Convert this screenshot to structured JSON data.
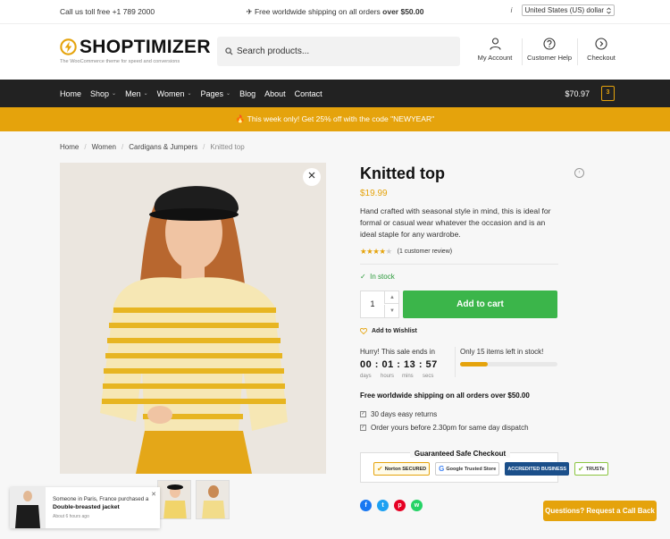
{
  "topbar": {
    "phone": "Call us toll free +1 789 2000",
    "shipping_prefix": "✈ Free worldwide shipping on all orders",
    "shipping_bold": "over $50.00",
    "info_icon": "i",
    "currency": "United States (US) dollar"
  },
  "header": {
    "logo_name": "SHOPTIMIZER",
    "tagline": "The WooCommerce theme for speed and conversions",
    "search_placeholder": "Search products...",
    "icons": [
      {
        "icon": "user-icon",
        "label": "My Account"
      },
      {
        "icon": "help-icon",
        "label": "Customer Help"
      },
      {
        "icon": "arrow-right-circle-icon",
        "label": "Checkout"
      }
    ]
  },
  "nav": {
    "items": [
      {
        "label": "Home",
        "dropdown": false
      },
      {
        "label": "Shop",
        "dropdown": true
      },
      {
        "label": "Men",
        "dropdown": true
      },
      {
        "label": "Women",
        "dropdown": true
      },
      {
        "label": "Pages",
        "dropdown": true
      },
      {
        "label": "Blog",
        "dropdown": false
      },
      {
        "label": "About",
        "dropdown": false
      },
      {
        "label": "Contact",
        "dropdown": false
      }
    ],
    "cart_total": "$70.97",
    "cart_count": "3"
  },
  "promo": {
    "text": "🔥 This week only! Get 25% off with the code \"NEWYEAR\""
  },
  "breadcrumb": [
    "Home",
    "Women",
    "Cardigans & Jumpers",
    "Knitted top"
  ],
  "product": {
    "title": "Knitted top",
    "price": "$19.99",
    "description": "Hand crafted with seasonal style in mind, this is ideal for formal or casual wear whatever the occasion and is an ideal staple for any wardrobe.",
    "rating": 4,
    "reviews": "(1 customer review)",
    "stock": "In stock",
    "quantity": "1",
    "add_to_cart": "Add to cart",
    "wishlist": "Add to Wishlist"
  },
  "sale": {
    "ends_label": "Hurry! This sale ends in",
    "time": "00 : 01 : 13 : 57",
    "units": [
      "days",
      "hours",
      "mins",
      "secs"
    ],
    "only_left": "Only 15 items left in stock!",
    "progress": 0.28
  },
  "shipping": {
    "headline": "Free worldwide shipping on all orders over $50.00",
    "bullets": [
      "30 days easy returns",
      "Order yours before 2.30pm for same day dispatch"
    ]
  },
  "checkout": {
    "label": "Guaranteed Safe Checkout",
    "badges": [
      "Norton SECURED",
      "Google Trusted Store",
      "ACCREDITED BUSINESS",
      "TRUSTe"
    ]
  },
  "colors": {
    "accent": "#e5a30c",
    "cta": "#3bb54a",
    "nav": "#222222",
    "stock": "#2a9a3a"
  },
  "share": [
    "f",
    "t",
    "p",
    "w"
  ],
  "toast": {
    "line1": "Someone in Paris, France purchased a",
    "product": "Double-breasted jacket",
    "time": "About 6 hours ago",
    "close": "✕"
  },
  "callback": "Questions? Request a Call Back"
}
